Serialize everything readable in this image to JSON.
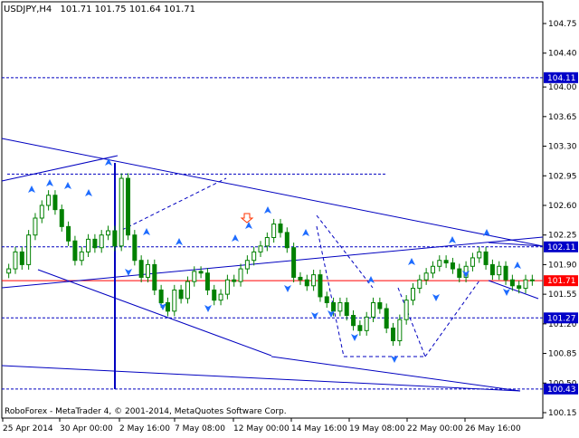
{
  "header": {
    "symbol": "USDJPY,H4",
    "ohlc": "101.71 101.75 101.64 101.71"
  },
  "footer": {
    "copyright": "RoboForex - MetaTrader 4, © 2001-2014, MetaQuotes Software Corp."
  },
  "colors": {
    "background": "#ffffff",
    "grid": "#000000",
    "candle": "#008000",
    "trend": "#0000c0",
    "arrow": "#1e6cff",
    "current_price_line": "#ff0000",
    "price_badge": "#0000c8",
    "forecast_arrow": "#ff3300"
  },
  "chart_data": {
    "type": "candlestick",
    "symbol": "USDJPY",
    "timeframe": "H4",
    "current_price": 101.71,
    "y_range": [
      100.1,
      104.9
    ],
    "y_ticks": [
      104.75,
      104.4,
      104.0,
      103.65,
      103.3,
      102.95,
      102.6,
      102.25,
      101.9,
      101.55,
      101.2,
      100.85,
      100.5,
      100.15
    ],
    "price_labels": [
      "104.11",
      "102.11",
      "101.71",
      "101.27",
      "100.43"
    ],
    "x_ticks": [
      "25 Apr 2014",
      "30 Apr 00:00",
      "2 May 16:00",
      "7 May 08:00",
      "12 May 00:00",
      "14 May 16:00",
      "19 May 08:00",
      "22 May 00:00",
      "26 May 16:00"
    ],
    "horizontal_levels": [
      {
        "price": 104.11,
        "style": "dotted"
      },
      {
        "price": 102.11,
        "style": "dotted"
      },
      {
        "price": 101.71,
        "style": "solid"
      },
      {
        "price": 101.27,
        "style": "dotted"
      },
      {
        "price": 100.43,
        "style": "dotted"
      },
      {
        "price": 102.97,
        "style": "dotted"
      }
    ],
    "closes": [
      101.85,
      102.05,
      101.9,
      102.25,
      102.45,
      102.6,
      102.72,
      102.55,
      102.35,
      102.18,
      101.95,
      102.05,
      102.2,
      102.1,
      102.25,
      102.3,
      102.12,
      102.92,
      102.25,
      101.95,
      101.75,
      101.9,
      101.6,
      101.45,
      101.35,
      101.6,
      101.5,
      101.7,
      101.82,
      101.8,
      101.6,
      101.48,
      101.55,
      101.72,
      101.7,
      101.85,
      101.95,
      102.05,
      102.12,
      102.22,
      102.38,
      102.28,
      102.1,
      101.75,
      101.72,
      101.65,
      101.78,
      101.52,
      101.45,
      101.35,
      101.45,
      101.3,
      101.18,
      101.12,
      101.28,
      101.45,
      101.38,
      101.15,
      101.0,
      101.25,
      101.48,
      101.62,
      101.72,
      101.8,
      101.88,
      101.95,
      101.92,
      101.85,
      101.75,
      101.88,
      101.98,
      102.05,
      101.9,
      101.78,
      101.88,
      101.72,
      101.65,
      101.62,
      101.72,
      101.71
    ]
  }
}
